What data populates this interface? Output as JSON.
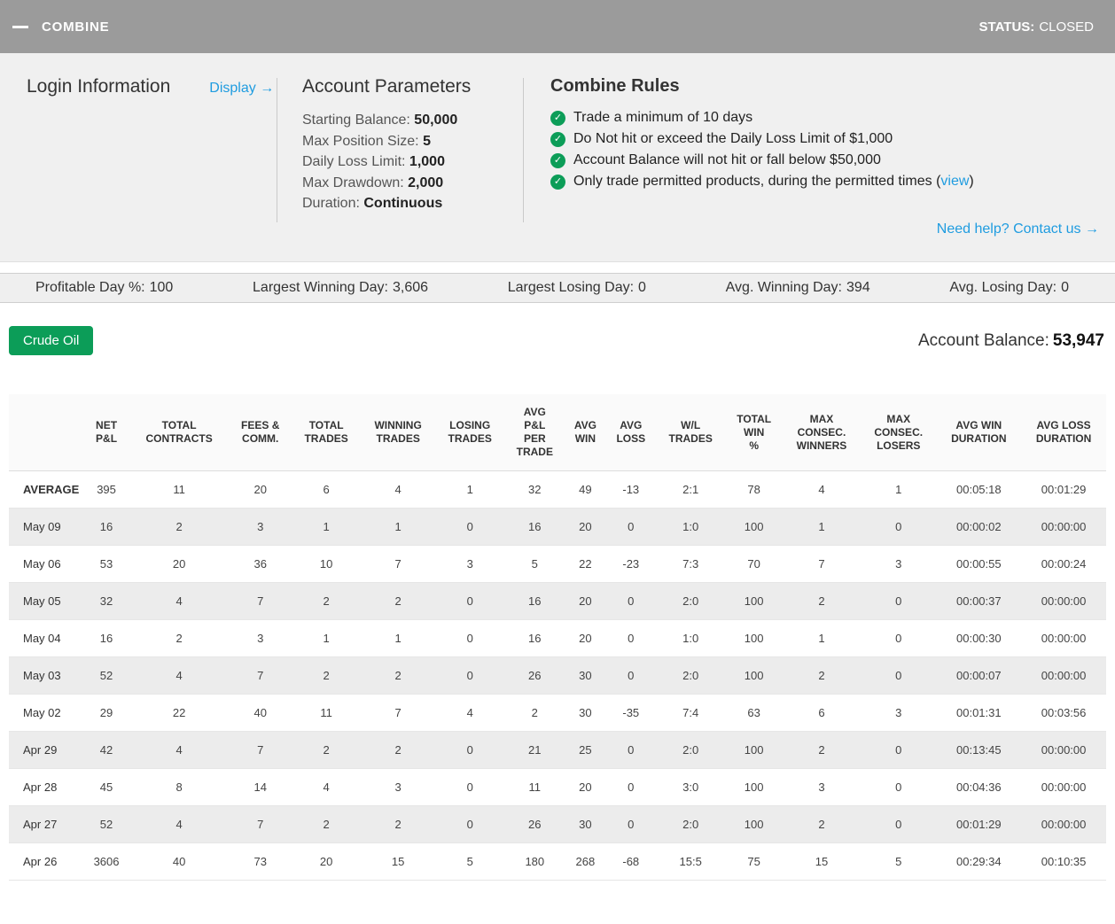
{
  "colors": {
    "accent_green": "#0c9d58",
    "link_blue": "#1f9ce0",
    "topbar_gray": "#9b9b9b"
  },
  "header": {
    "title": "COMBINE",
    "status_label": "STATUS:",
    "status_value": "CLOSED"
  },
  "login": {
    "title": "Login Information",
    "display_link": "Display →"
  },
  "account_parameters": {
    "title": "Account Parameters",
    "items": [
      {
        "label": "Starting Balance: ",
        "value": "50,000"
      },
      {
        "label": "Max Position Size: ",
        "value": "5"
      },
      {
        "label": "Daily Loss Limit: ",
        "value": "1,000"
      },
      {
        "label": "Max Drawdown: ",
        "value": "2,000"
      },
      {
        "label": "Duration: ",
        "value": "Continuous"
      }
    ]
  },
  "combine_rules": {
    "title": "Combine Rules",
    "rules": [
      {
        "pre": "Trade a minimum of 10 days",
        "link": "",
        "post": ""
      },
      {
        "pre": "Do Not hit or exceed the Daily Loss Limit of $1,000",
        "link": "",
        "post": ""
      },
      {
        "pre": "Account Balance will not hit or fall below $50,000",
        "link": "",
        "post": ""
      },
      {
        "pre": "Only trade permitted products, during the permitted times (",
        "link": "view",
        "post": ")"
      }
    ],
    "help_link": "Need help? Contact us →"
  },
  "stats_bar": [
    {
      "label": "Profitable Day %:",
      "value": "100"
    },
    {
      "label": "Largest Winning Day:",
      "value": "3,606"
    },
    {
      "label": "Largest Losing Day:",
      "value": "0"
    },
    {
      "label": "Avg. Winning Day:",
      "value": "394"
    },
    {
      "label": "Avg. Losing Day:",
      "value": "0"
    }
  ],
  "toolbar": {
    "product": "Crude Oil",
    "balance_label": "Account Balance:",
    "balance_value": "53,947"
  },
  "table": {
    "columns": [
      "",
      "NET\nP&L",
      "TOTAL\nCONTRACTS",
      "FEES &\nCOMM.",
      "TOTAL\nTRADES",
      "WINNING\nTRADES",
      "LOSING\nTRADES",
      "AVG\nP&L\nPER\nTRADE",
      "AVG\nWIN",
      "AVG\nLOSS",
      "W/L\nTRADES",
      "TOTAL\nWIN\n%",
      "MAX\nCONSEC.\nWINNERS",
      "MAX\nCONSEC.\nLOSERS",
      "AVG WIN\nDURATION",
      "AVG LOSS\nDURATION"
    ],
    "rows": [
      [
        "AVERAGE",
        "395",
        "11",
        "20",
        "6",
        "4",
        "1",
        "32",
        "49",
        "-13",
        "2:1",
        "78",
        "4",
        "1",
        "00:05:18",
        "00:01:29"
      ],
      [
        "May 09",
        "16",
        "2",
        "3",
        "1",
        "1",
        "0",
        "16",
        "20",
        "0",
        "1:0",
        "100",
        "1",
        "0",
        "00:00:02",
        "00:00:00"
      ],
      [
        "May 06",
        "53",
        "20",
        "36",
        "10",
        "7",
        "3",
        "5",
        "22",
        "-23",
        "7:3",
        "70",
        "7",
        "3",
        "00:00:55",
        "00:00:24"
      ],
      [
        "May 05",
        "32",
        "4",
        "7",
        "2",
        "2",
        "0",
        "16",
        "20",
        "0",
        "2:0",
        "100",
        "2",
        "0",
        "00:00:37",
        "00:00:00"
      ],
      [
        "May 04",
        "16",
        "2",
        "3",
        "1",
        "1",
        "0",
        "16",
        "20",
        "0",
        "1:0",
        "100",
        "1",
        "0",
        "00:00:30",
        "00:00:00"
      ],
      [
        "May 03",
        "52",
        "4",
        "7",
        "2",
        "2",
        "0",
        "26",
        "30",
        "0",
        "2:0",
        "100",
        "2",
        "0",
        "00:00:07",
        "00:00:00"
      ],
      [
        "May 02",
        "29",
        "22",
        "40",
        "11",
        "7",
        "4",
        "2",
        "30",
        "-35",
        "7:4",
        "63",
        "6",
        "3",
        "00:01:31",
        "00:03:56"
      ],
      [
        "Apr 29",
        "42",
        "4",
        "7",
        "2",
        "2",
        "0",
        "21",
        "25",
        "0",
        "2:0",
        "100",
        "2",
        "0",
        "00:13:45",
        "00:00:00"
      ],
      [
        "Apr 28",
        "45",
        "8",
        "14",
        "4",
        "3",
        "0",
        "11",
        "20",
        "0",
        "3:0",
        "100",
        "3",
        "0",
        "00:04:36",
        "00:00:00"
      ],
      [
        "Apr 27",
        "52",
        "4",
        "7",
        "2",
        "2",
        "0",
        "26",
        "30",
        "0",
        "2:0",
        "100",
        "2",
        "0",
        "00:01:29",
        "00:00:00"
      ],
      [
        "Apr 26",
        "3606",
        "40",
        "73",
        "20",
        "15",
        "5",
        "180",
        "268",
        "-68",
        "15:5",
        "75",
        "15",
        "5",
        "00:29:34",
        "00:10:35"
      ]
    ]
  }
}
